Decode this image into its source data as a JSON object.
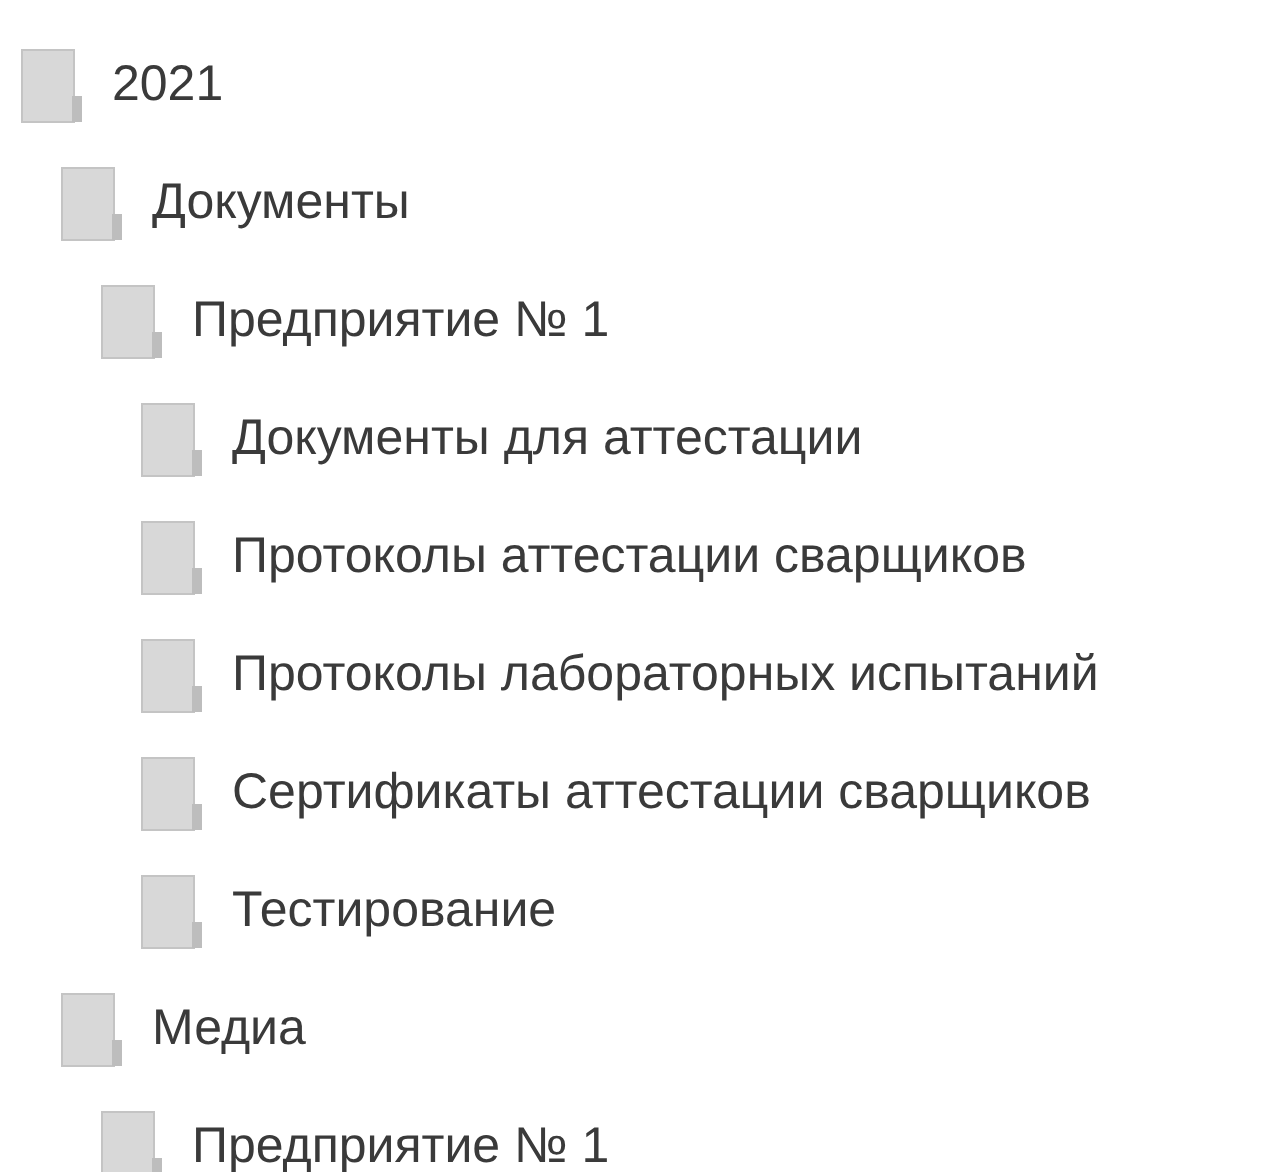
{
  "tree": [
    {
      "label": "2021",
      "children": [
        {
          "label": "Документы",
          "children": [
            {
              "label": "Предприятие № 1",
              "children": [
                {
                  "label": "Документы для аттестации"
                },
                {
                  "label": "Протоколы аттестации сварщиков"
                },
                {
                  "label": "Протоколы лабораторных испытаний"
                },
                {
                  "label": "Сертификаты аттестации сварщиков"
                },
                {
                  "label": "Тестирование"
                }
              ]
            }
          ]
        },
        {
          "label": "Медиа",
          "children": [
            {
              "label": "Предприятие № 1"
            }
          ]
        }
      ]
    }
  ]
}
